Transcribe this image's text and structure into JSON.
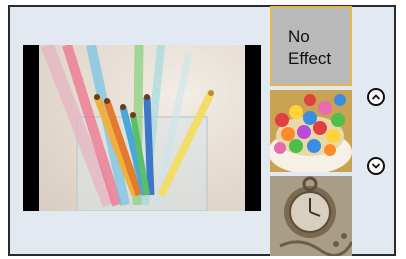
{
  "effects": {
    "selected_label": "No\nEffect"
  },
  "navigation": {
    "up_icon": "chevron-up-icon",
    "down_icon": "chevron-down-icon"
  },
  "colors": {
    "selection_border": "#e3b84f",
    "panel_background": "#e3e9f1"
  }
}
